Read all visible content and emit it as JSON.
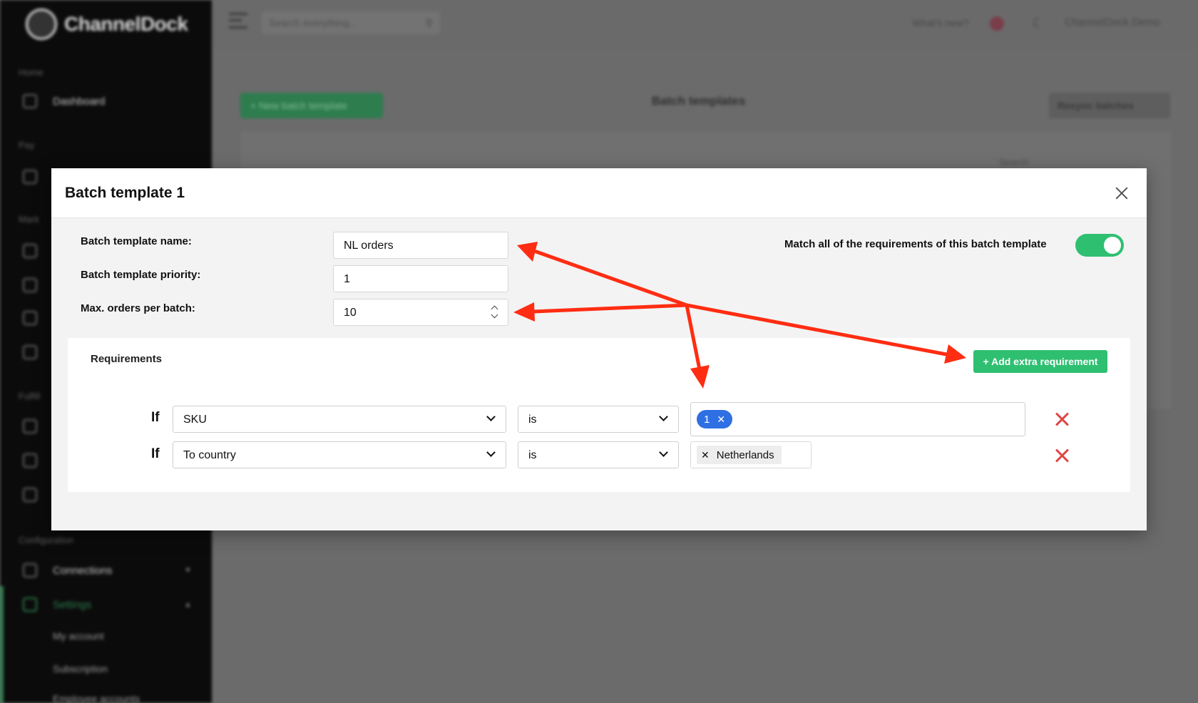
{
  "app": {
    "logo_text": "ChannelDock",
    "sidebar": {
      "sections": [
        "Home",
        "Pay",
        "Mark",
        "Fulfill",
        "Configuration"
      ],
      "items": [
        {
          "label": "Dashboard"
        },
        {
          "label": "Connections"
        },
        {
          "label": "Settings"
        }
      ],
      "subitems": [
        "My account",
        "Subscription",
        "Employee accounts"
      ]
    },
    "topbar": {
      "search_placeholder": "Search everything...",
      "whats_new": "What's new?",
      "user": "ChannelDock Demo"
    },
    "page": {
      "new_button": "+ New batch template",
      "title": "Batch templates",
      "resync_button": "Resync batches",
      "search_label": "Search"
    }
  },
  "modal": {
    "title": "Batch template 1",
    "fields": {
      "name": {
        "label": "Batch template name:",
        "value": "NL orders"
      },
      "priority": {
        "label": "Batch template priority:",
        "value": "1"
      },
      "max_orders": {
        "label": "Max. orders per batch:",
        "value": "10"
      }
    },
    "match_all": {
      "label": "Match all of the requirements of this batch template",
      "enabled": true
    },
    "requirements": {
      "title": "Requirements",
      "add_button": "+ Add extra requirement",
      "rows": [
        {
          "prefix": "If",
          "field": "SKU",
          "operator": "is",
          "values": [
            "1"
          ]
        },
        {
          "prefix": "If",
          "field": "To country",
          "operator": "is",
          "values": [
            "Netherlands"
          ]
        }
      ]
    }
  },
  "colors": {
    "accent_green": "#2fbf71",
    "pill_blue": "#2f6fe4",
    "delete_red": "#e04646",
    "annotation_red": "#ff2d12"
  }
}
